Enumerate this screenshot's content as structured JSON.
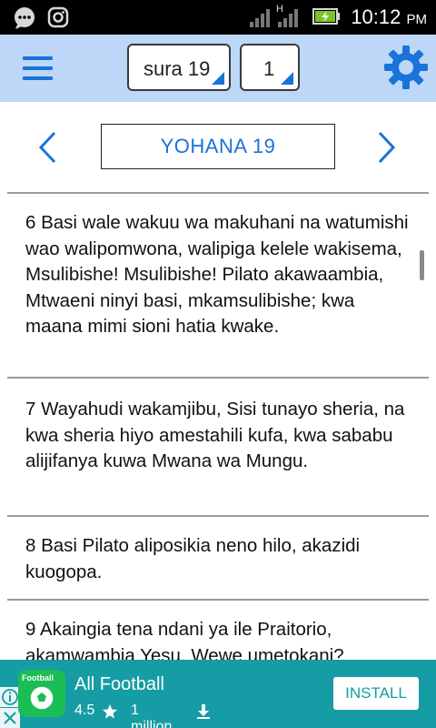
{
  "status_bar": {
    "time": "10:12",
    "ampm": "PM",
    "icons": [
      "chat-bubble-icon",
      "instagram-icon",
      "signal-icon",
      "signal-h-icon",
      "battery-charging-icon"
    ],
    "network_label": "H"
  },
  "toolbar": {
    "menu_icon": "hamburger-menu-icon",
    "chapter_select": "sura 19",
    "verse_select": "1",
    "settings_icon": "gear-icon",
    "colors": {
      "background": "#bcd7f7",
      "accent": "#1a73d9"
    }
  },
  "navigation": {
    "title": "YOHANA 19",
    "prev_icon": "chevron-left-icon",
    "next_icon": "chevron-right-icon"
  },
  "verses": [
    {
      "text": "6 Basi wale wakuu wa makuhani na watumishi wao walipomwona, walipiga kelele wakisema, Msulibishe! Msulibishe! Pilato akawaambia, Mtwaeni ninyi basi, mkamsulibishe; kwa maana mimi sioni hatia kwake."
    },
    {
      "text": "7 Wayahudi wakamjibu, Sisi tunayo sheria, na kwa sheria hiyo amestahili kufa, kwa sababu alijifanya kuwa Mwana wa Mungu."
    },
    {
      "text": "8 Basi Pilato aliposikia neno hilo, akazidi kuogopa."
    },
    {
      "text": "9 Akaingia tena ndani ya ile Praitorio, akamwambia Yesu, Wewe umetokani?"
    }
  ],
  "ad": {
    "app_name": "All Football",
    "logo_text": "Football",
    "rating": "4.5",
    "installs": "1 million",
    "install_label": "INSTALL",
    "colors": {
      "background": "#169ca4",
      "logo": "#1bbd55"
    }
  }
}
